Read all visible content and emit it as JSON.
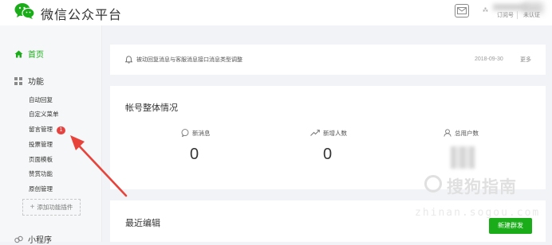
{
  "header": {
    "brand": "微信公众平台",
    "account_type": "订阅号",
    "account_status": "未认证"
  },
  "sidebar": {
    "home": "首页",
    "functions": "功能",
    "items": [
      {
        "label": "自动回复"
      },
      {
        "label": "自定义菜单"
      },
      {
        "label": "留言管理",
        "badge": "1"
      },
      {
        "label": "投票管理"
      },
      {
        "label": "页面模板"
      },
      {
        "label": "赞赏功能"
      },
      {
        "label": "原创管理"
      }
    ],
    "add_plugin": "添加功能插件",
    "mini_program": "小程序"
  },
  "notice": {
    "text": "被动回复消息与客服消息接口消息类型调整",
    "date": "2018-09-30",
    "more": "更多"
  },
  "overview": {
    "title": "帐号整体情况",
    "stats": [
      {
        "label": "新消息",
        "value": "0"
      },
      {
        "label": "新增人数",
        "value": "0"
      },
      {
        "label": "总用户数",
        "value": ""
      }
    ]
  },
  "recent": {
    "title": "最近编辑",
    "new_button": "新建群发"
  },
  "watermark": {
    "main": "搜狗指南",
    "sub": "zhinan.sogou.com"
  },
  "colors": {
    "accent": "#1aad19",
    "badge": "#e64340",
    "arrow": "#e8433b"
  }
}
